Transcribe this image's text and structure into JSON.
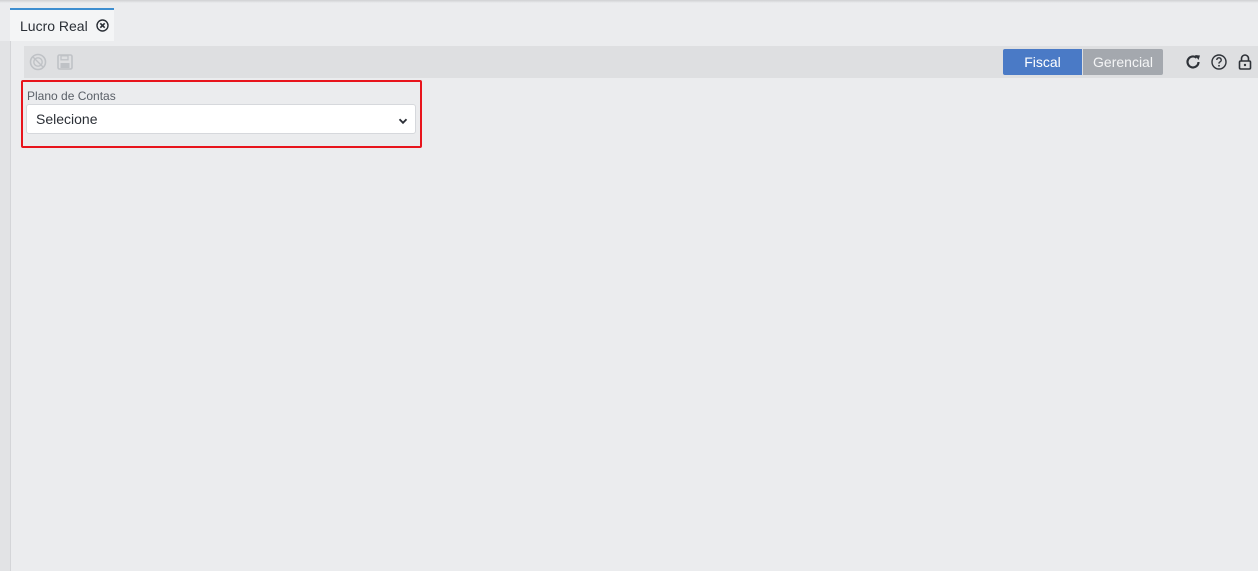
{
  "tab": {
    "label": "Lucro Real",
    "close_icon": "close-circle-icon"
  },
  "toolbar": {
    "left_icons": [
      "disabled-circle-icon",
      "save-icon"
    ],
    "segments": {
      "fiscal_label": "Fiscal",
      "gerencial_label": "Gerencial",
      "active": "Fiscal"
    },
    "right_icons": [
      "refresh-icon",
      "help-icon",
      "lock-icon"
    ]
  },
  "form": {
    "plano_label": "Plano de Contas",
    "plano_value": "Selecione"
  },
  "colors": {
    "accent": "#4a7ac6",
    "inactive_segment": "#a4a8ae",
    "highlight_border": "#e8141c",
    "tab_indicator": "#3e8ed0"
  }
}
